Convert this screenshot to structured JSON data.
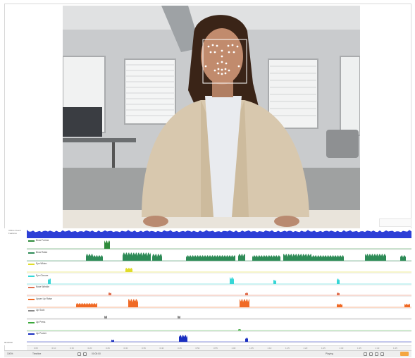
{
  "video": {
    "label": "video-frame-with-face-landmarks"
  },
  "left_panel": {
    "title": "Offline Fluent Features"
  },
  "tracks": [
    {
      "name": "Brow Furrow",
      "color": "#2e8b3a"
    },
    {
      "name": "Brow Raise",
      "color": "#2e8b57"
    },
    {
      "name": "Eye Widen",
      "color": "#e0dc2a"
    },
    {
      "name": "Eye Closure",
      "color": "#36d6d6"
    },
    {
      "name": "Nose Wrinkle",
      "color": "#e07050"
    },
    {
      "name": "Upper Lip Raise",
      "color": "#f06a25"
    },
    {
      "name": "Lip Suck",
      "color": "#8a8a8a"
    },
    {
      "name": "Lip Press",
      "color": "#3aa83a"
    },
    {
      "name": "Lip Pucker",
      "color": "#1a2fc0"
    }
  ],
  "left_ruler": {
    "label": "00:00:00"
  },
  "ruler": {
    "ticks": [
      "0:05",
      "0:10",
      "0:15",
      "0:20",
      "0:25",
      "0:30",
      "0:35",
      "0:40",
      "0:45",
      "0:50",
      "0:55",
      "1:00",
      "1:05",
      "1:10",
      "1:15",
      "1:20",
      "1:25",
      "1:30",
      "1:35",
      "1:40",
      "1:45"
    ]
  },
  "statusbar": {
    "left_label": "100%",
    "mid_label": "Timeline",
    "right_label": "Playing",
    "time_label": "00:00:00"
  },
  "colors": {
    "top_signal": "#2d3fd6",
    "background": "#ffffff"
  }
}
